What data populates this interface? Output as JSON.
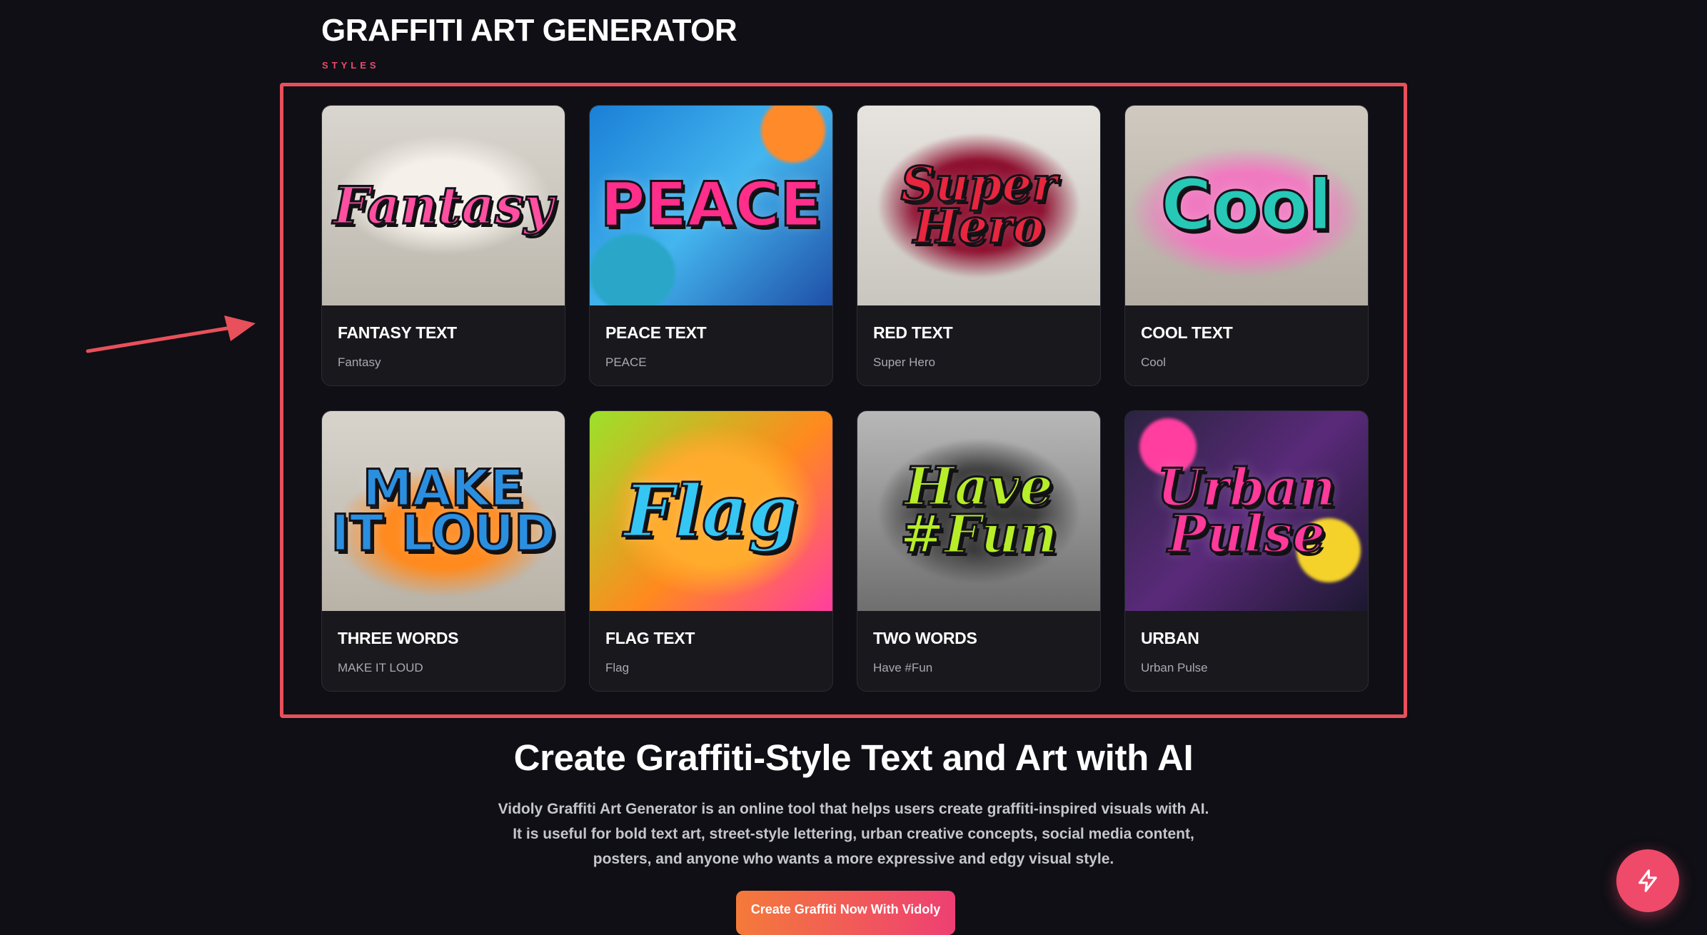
{
  "header": {
    "title": "GRAFFITI ART GENERATOR",
    "subtitle": "STYLES"
  },
  "styles": [
    {
      "title": "FANTASY TEXT",
      "sample": "Fantasy",
      "art": "Fantasy"
    },
    {
      "title": "PEACE TEXT",
      "sample": "PEACE",
      "art": "PEACE"
    },
    {
      "title": "RED TEXT",
      "sample": "Super Hero",
      "art": "Super Hero"
    },
    {
      "title": "COOL TEXT",
      "sample": "Cool",
      "art": "Cool"
    },
    {
      "title": "THREE WORDS",
      "sample": "MAKE IT LOUD",
      "art": "MAKE IT LOUD"
    },
    {
      "title": "FLAG TEXT",
      "sample": "Flag",
      "art": "Flag"
    },
    {
      "title": "TWO WORDS",
      "sample": "Have #Fun",
      "art": "Have #Fun"
    },
    {
      "title": "URBAN",
      "sample": "Urban Pulse",
      "art": "Urban Pulse"
    }
  ],
  "hero": {
    "heading": "Create Graffiti-Style Text and Art with AI",
    "line1": "Vidoly Graffiti Art Generator is an online tool that helps users create graffiti-inspired visuals with AI.",
    "line2": "It is useful for bold text art, street-style lettering, urban creative concepts, social media content,",
    "line3": "posters, and anyone who wants a more expressive and edgy visual style.",
    "cta_label": "Create Graffiti Now With Vidoly"
  },
  "icons": {
    "fab": "lightning-icon",
    "annotation": "arrow-annotation-icon"
  },
  "colors": {
    "background": "#0f0f15",
    "accent": "#ef4a6a",
    "highlight_frame": "#e8505b"
  }
}
